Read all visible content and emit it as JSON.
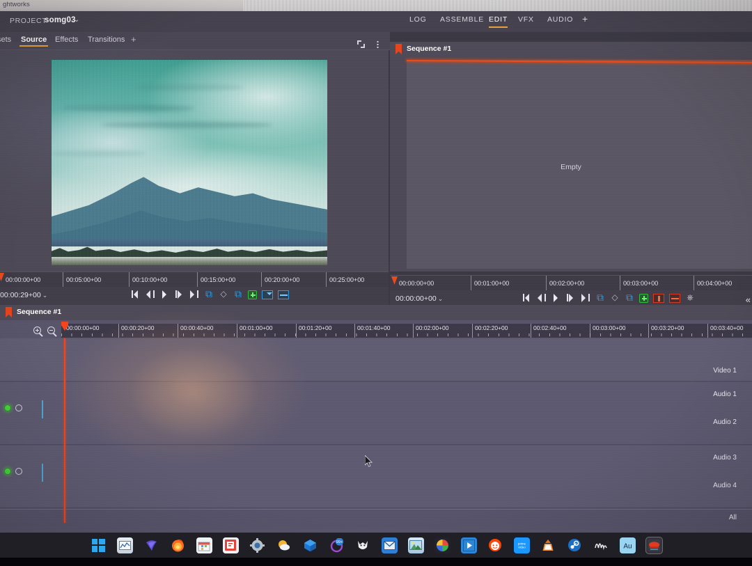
{
  "os": {
    "desktop_label": "ghtworks"
  },
  "project_bar": {
    "label": "PROJECT",
    "name": "somg03",
    "caret": "⌄"
  },
  "module_tabs": [
    {
      "label": "LOG",
      "active": false
    },
    {
      "label": "ASSEMBLE",
      "active": false
    },
    {
      "label": "EDIT",
      "active": true
    },
    {
      "label": "VFX",
      "active": false
    },
    {
      "label": "AUDIO",
      "active": false
    },
    {
      "label": "+",
      "active": false
    }
  ],
  "bin_tabs": [
    {
      "label": "sets",
      "active": false
    },
    {
      "label": "Source",
      "active": true
    },
    {
      "label": "Effects",
      "active": false
    },
    {
      "label": "Transitions",
      "active": false
    },
    {
      "label": "+",
      "active": false
    }
  ],
  "source_viewer": {
    "fullscreen_icon": "fullscreen-icon",
    "menu_icon": "kebab-menu-icon",
    "clip_description": "teal-tinted mountain landscape with clouds"
  },
  "sequence_viewer": {
    "title": "Sequence #1",
    "empty_label": "Empty"
  },
  "source_ruler": {
    "ticks": [
      "00:00:00+00",
      "00:05:00+00",
      "00:10:00+00",
      "00:15:00+00",
      "00:20:00+00",
      "00:25:00+00"
    ]
  },
  "record_ruler": {
    "ticks": [
      "00:00:00+00",
      "00:01:00+00",
      "00:02:00+00",
      "00:03:00+00",
      "00:04:00+00"
    ]
  },
  "source_transport": {
    "timecode": "00:00:29+00",
    "caret": "⌄",
    "buttons": [
      "go-to-start-button",
      "step-back-button",
      "play-button",
      "step-forward-button",
      "go-to-end-button",
      "mark-in-button",
      "mark-clip-button",
      "mark-out-button",
      "add-edit-button",
      "insert-button",
      "replace-button"
    ]
  },
  "record_transport": {
    "timecode": "00:00:00+00",
    "caret": "⌄",
    "buttons": [
      "go-to-start-button",
      "step-back-button",
      "play-button",
      "step-forward-button",
      "go-to-end-button",
      "mark-in-button",
      "mark-clip-button",
      "mark-out-button",
      "add-edit-button",
      "delete-button",
      "remove-button",
      "voice-over-button"
    ],
    "overflow_icon": "chevrons-icon"
  },
  "timeline": {
    "sequence_title": "Sequence #1",
    "zoom_in_icon": "zoom-in-icon",
    "zoom_out_icon": "zoom-out-icon",
    "ruler_ticks": [
      "00:00:00+00",
      "00:00:20+00",
      "00:00:40+00",
      "00:01:00+00",
      "00:01:20+00",
      "00:01:40+00",
      "00:02:00+00",
      "00:02:20+00",
      "00:02:40+00",
      "00:03:00+00",
      "00:03:20+00",
      "00:03:40+00"
    ],
    "tracks": [
      {
        "name": "Video 1"
      },
      {
        "name": "Audio 1"
      },
      {
        "name": "Audio 2"
      },
      {
        "name": "Audio 3"
      },
      {
        "name": "Audio 4"
      },
      {
        "name": "All"
      }
    ],
    "playhead_position": "00:00:00+00"
  },
  "colors": {
    "accent_orange": "#e8a33d",
    "playhead_red": "#f8431a",
    "track_enabled_green": "#4ad43f",
    "mark_blue": "#2f9de0",
    "panel_bg": "#4d4956",
    "timeline_bg": "#58546a"
  },
  "taskbar": {
    "icons": [
      "windows-start-icon",
      "task-view-icon",
      "thunderbird-icon",
      "firefox-icon",
      "store-icon",
      "wps-presentation-icon",
      "settings-icon",
      "weather-icon",
      "3d-viewer-icon",
      "notification-badge-icon",
      "wolf-icon",
      "mail-icon",
      "photos-icon",
      "color-picker-icon",
      "media-player-icon",
      "reddit-icon",
      "prime-video-icon",
      "vlc-icon",
      "steam-icon",
      "audacity-icon",
      "adobe-audition-icon",
      "lightworks-icon"
    ],
    "badge_count": "99+"
  }
}
